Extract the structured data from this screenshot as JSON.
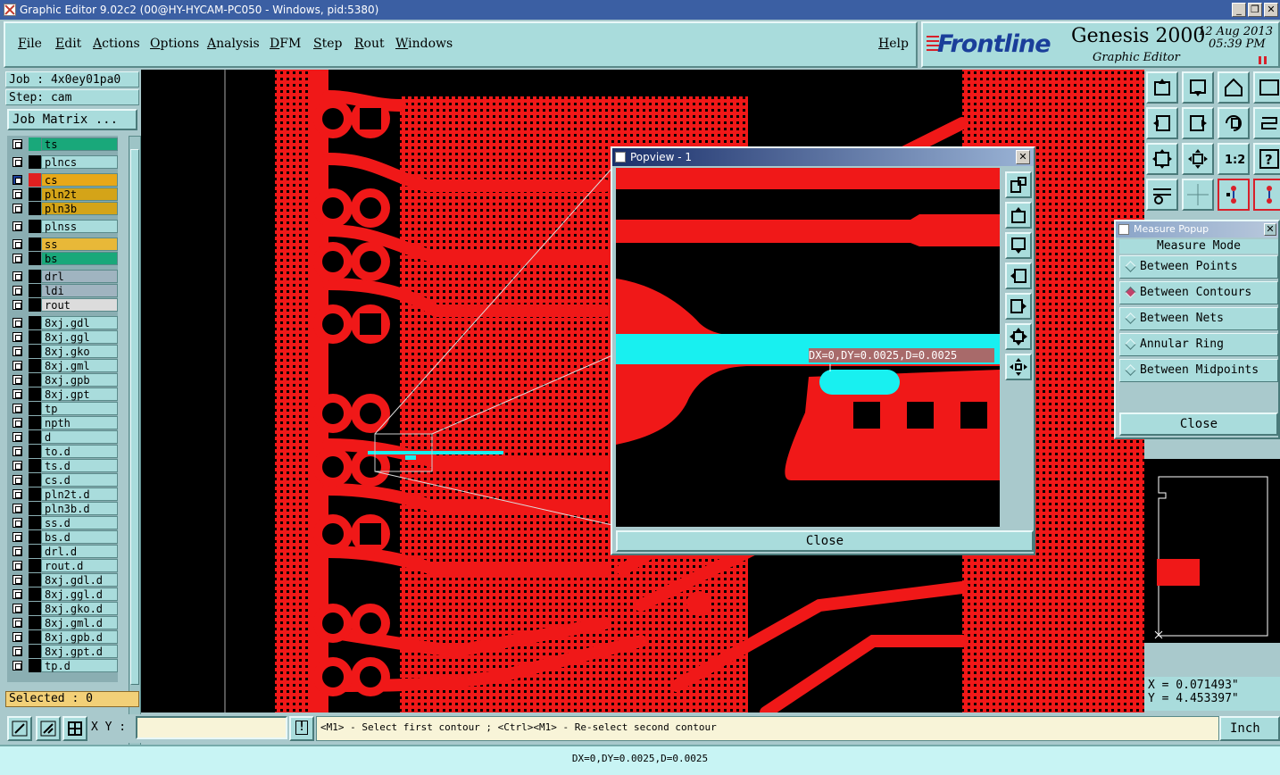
{
  "window": {
    "title": "Graphic Editor 9.02c2 (00@HY-HYCAM-PC050 - Windows, pid:5380)",
    "controls": [
      "_",
      "❐",
      "✕"
    ]
  },
  "menubar": {
    "items": [
      "File",
      "Edit",
      "Actions",
      "Options",
      "Analysis",
      "DFM",
      "Step",
      "Rout",
      "Windows"
    ],
    "help": "Help"
  },
  "brand": {
    "logo": "Frontline",
    "product": "Genesis 2000",
    "subtitle": "Graphic Editor",
    "date": "12 Aug 2013",
    "time": "05:39 PM"
  },
  "job": {
    "job_label": "Job : 4x0ey01pa0",
    "step_label": "Step: cam",
    "matrix_button": "Job Matrix ..."
  },
  "layers": [
    {
      "name": "ts",
      "color": "#19a87a",
      "bg": "#19a87a"
    },
    {
      "name": "plncs",
      "color": "#000000",
      "bg": "#a9dcdc"
    },
    {
      "name": "cs",
      "color": "#e02020",
      "bg": "#e8a818",
      "active": true
    },
    {
      "name": "pln2t",
      "color": "#000000",
      "bg": "#d4a418"
    },
    {
      "name": "pln3b",
      "color": "#000000",
      "bg": "#d4a418"
    },
    {
      "name": "plnss",
      "color": "#000000",
      "bg": "#a9dcdc"
    },
    {
      "name": "ss",
      "color": "#000000",
      "bg": "#e8b838"
    },
    {
      "name": "bs",
      "color": "#000000",
      "bg": "#19a87a"
    },
    {
      "name": "drl",
      "color": "#000000",
      "bg": "#a0b4c0"
    },
    {
      "name": "ldi",
      "color": "#000000",
      "bg": "#a0b4c0"
    },
    {
      "name": "rout",
      "color": "#000000",
      "bg": "#dcdcdc"
    },
    {
      "name": "8xj.gdl",
      "color": "#000000",
      "bg": "#a9dcdc"
    },
    {
      "name": "8xj.ggl",
      "color": "#000000",
      "bg": "#a9dcdc"
    },
    {
      "name": "8xj.gko",
      "color": "#000000",
      "bg": "#a9dcdc"
    },
    {
      "name": "8xj.gml",
      "color": "#000000",
      "bg": "#a9dcdc"
    },
    {
      "name": "8xj.gpb",
      "color": "#000000",
      "bg": "#a9dcdc"
    },
    {
      "name": "8xj.gpt",
      "color": "#000000",
      "bg": "#a9dcdc"
    },
    {
      "name": "tp",
      "color": "#000000",
      "bg": "#a9dcdc"
    },
    {
      "name": "npth",
      "color": "#000000",
      "bg": "#a9dcdc"
    },
    {
      "name": "d",
      "color": "#000000",
      "bg": "#a9dcdc"
    },
    {
      "name": "to.d",
      "color": "#000000",
      "bg": "#a9dcdc"
    },
    {
      "name": "ts.d",
      "color": "#000000",
      "bg": "#a9dcdc"
    },
    {
      "name": "cs.d",
      "color": "#000000",
      "bg": "#a9dcdc"
    },
    {
      "name": "pln2t.d",
      "color": "#000000",
      "bg": "#a9dcdc"
    },
    {
      "name": "pln3b.d",
      "color": "#000000",
      "bg": "#a9dcdc"
    },
    {
      "name": "ss.d",
      "color": "#000000",
      "bg": "#a9dcdc"
    },
    {
      "name": "bs.d",
      "color": "#000000",
      "bg": "#a9dcdc"
    },
    {
      "name": "drl.d",
      "color": "#000000",
      "bg": "#a9dcdc"
    },
    {
      "name": "rout.d",
      "color": "#000000",
      "bg": "#a9dcdc"
    },
    {
      "name": "8xj.gdl.d",
      "color": "#000000",
      "bg": "#a9dcdc"
    },
    {
      "name": "8xj.ggl.d",
      "color": "#000000",
      "bg": "#a9dcdc"
    },
    {
      "name": "8xj.gko.d",
      "color": "#000000",
      "bg": "#a9dcdc"
    },
    {
      "name": "8xj.gml.d",
      "color": "#000000",
      "bg": "#a9dcdc"
    },
    {
      "name": "8xj.gpb.d",
      "color": "#000000",
      "bg": "#a9dcdc"
    },
    {
      "name": "8xj.gpt.d",
      "color": "#000000",
      "bg": "#a9dcdc"
    },
    {
      "name": "tp.d",
      "color": "#000000",
      "bg": "#a9dcdc"
    }
  ],
  "selected_label": "Selected : 0",
  "popview": {
    "title": "Popview - 1",
    "measure_text": "DX=0,DY=0.0025,D=0.0025",
    "close_button": "Close"
  },
  "measure_popup": {
    "title": "Measure Popup",
    "heading": "Measure Mode",
    "options": [
      "Between Points",
      "Between Contours",
      "Between Nets",
      "Annular Ring",
      "Between Midpoints"
    ],
    "selected_option": "Between Contours",
    "close_button": "Close"
  },
  "coords": {
    "x": "X = 0.071493\"",
    "y": "Y = 4.453397\""
  },
  "command_bar": {
    "xy_label": "X Y :",
    "xy_value": "",
    "prompt": "<M1> - Select first contour ; <Ctrl><M1> - Re-select second contour",
    "units": "Inch"
  },
  "status_text": "DX=0,DY=0.0025,D=0.0025",
  "colors": {
    "copper": "#f01818",
    "measure": "#18f0f0",
    "panel": "#a9dcdc"
  }
}
